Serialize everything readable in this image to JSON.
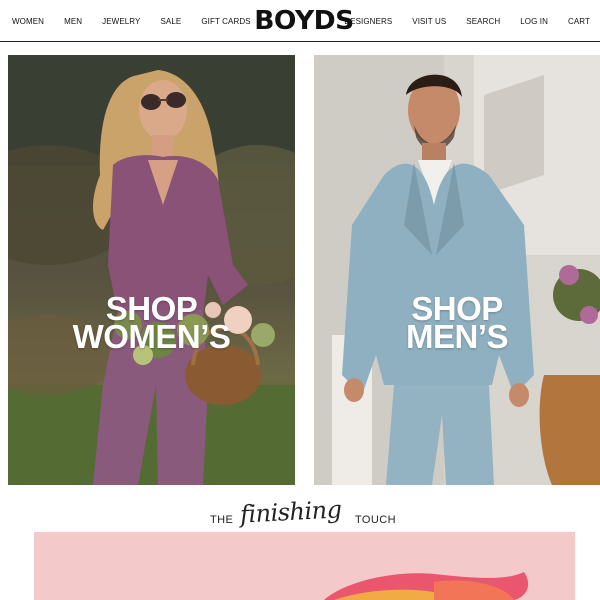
{
  "header": {
    "nav_left": [
      "WOMEN",
      "MEN",
      "JEWELRY",
      "SALE",
      "GIFT CARDS"
    ],
    "logo": "BOYDS",
    "nav_right": [
      "DESIGNERS",
      "VISIT US",
      "SEARCH",
      "LOG IN",
      "CART"
    ]
  },
  "hero": {
    "women": {
      "line1": "SHOP",
      "line2": "WOMEN’S"
    },
    "men": {
      "line1": "SHOP",
      "line2": "MEN’S"
    }
  },
  "finishing": {
    "the": "THE",
    "script": "finishing",
    "touch": "TOUCH"
  },
  "colors": {
    "accent_text": "#111111",
    "promo_bg": "#f4c9c9"
  }
}
